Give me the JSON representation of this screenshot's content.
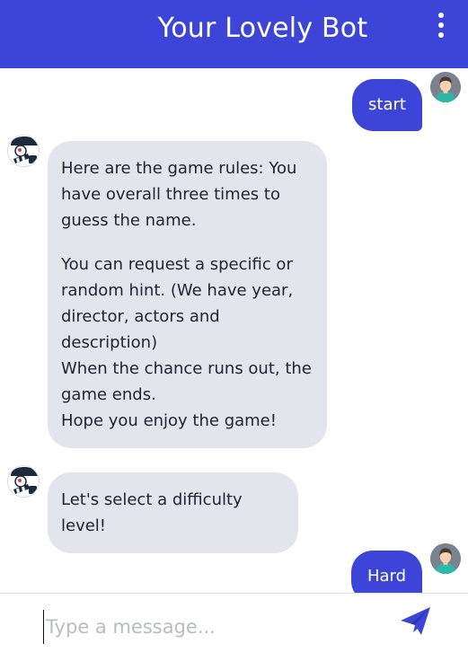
{
  "header": {
    "title": "Your Lovely Bot",
    "menu_icon": "more-vertical-icon"
  },
  "colors": {
    "brand": "#3d45d8",
    "bot_bubble": "#e2e6ec",
    "background": "#ffffff"
  },
  "messages": [
    {
      "sender": "user",
      "text": "start",
      "avatar_icon": "user-avatar-icon"
    },
    {
      "sender": "bot",
      "avatar_icon": "bot-avatar-icon",
      "paragraphs": [
        "Here are the game rules: You have overall three times to guess the name.",
        "You can request a specific or random hint. (We have year, director, actors and description)\nWhen the chance runs out, the game ends.\nHope you enjoy the game!"
      ]
    },
    {
      "sender": "bot",
      "avatar_icon": "bot-avatar-icon",
      "paragraphs": [
        "Let's select a difficulty level!"
      ]
    },
    {
      "sender": "user",
      "text": "Hard",
      "avatar_icon": "user-avatar-icon"
    }
  ],
  "composer": {
    "placeholder": "Type a message...",
    "value": "",
    "send_icon": "send-icon"
  }
}
